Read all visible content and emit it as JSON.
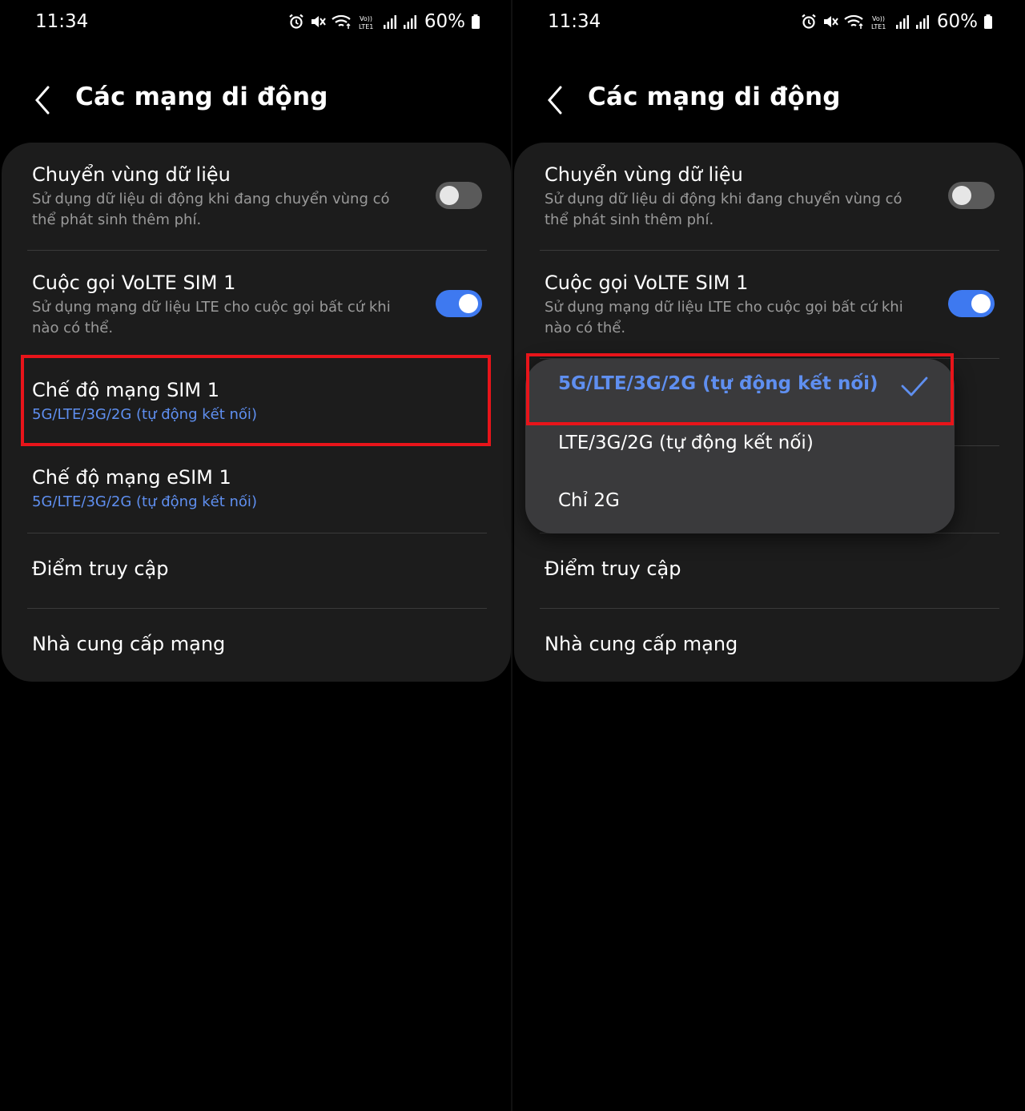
{
  "left": {
    "status": {
      "time": "11:34",
      "battery": "60%"
    },
    "header": {
      "title": "Các mạng di động"
    },
    "items": [
      {
        "title": "Chuyển vùng dữ liệu",
        "subtitle": "Sử dụng dữ liệu di động khi đang chuyển vùng có thể phát sinh thêm phí.",
        "toggle": "off"
      },
      {
        "title": "Cuộc gọi VoLTE SIM 1",
        "subtitle": "Sử dụng mạng dữ liệu LTE cho cuộc gọi bất cứ khi nào có thể.",
        "toggle": "on"
      },
      {
        "title": "Chế độ mạng SIM 1",
        "value": "5G/LTE/3G/2G (tự động kết nối)"
      },
      {
        "title": "Chế độ mạng eSIM 1",
        "value": "5G/LTE/3G/2G (tự động kết nối)"
      },
      {
        "title": "Điểm truy cập"
      },
      {
        "title": "Nhà cung cấp mạng"
      }
    ]
  },
  "right": {
    "status": {
      "time": "11:34",
      "battery": "60%"
    },
    "header": {
      "title": "Các mạng di động"
    },
    "items": [
      {
        "title": "Chuyển vùng dữ liệu",
        "subtitle": "Sử dụng dữ liệu di động khi đang chuyển vùng có thể phát sinh thêm phí.",
        "toggle": "off"
      },
      {
        "title": "Cuộc gọi VoLTE SIM 1",
        "subtitle": "Sử dụng mạng dữ liệu LTE cho cuộc gọi bất cứ khi nào có thể.",
        "toggle": "on"
      },
      {
        "title": "Điểm truy cập"
      },
      {
        "title": "Nhà cung cấp mạng"
      }
    ],
    "network_mode_menu": {
      "options": [
        {
          "label": "5G/LTE/3G/2G (tự động kết nối)",
          "selected": true
        },
        {
          "label": "LTE/3G/2G (tự động kết nối)",
          "selected": false
        },
        {
          "label": "Chỉ 2G",
          "selected": false
        }
      ]
    }
  },
  "colors": {
    "accent": "#5f8ff0",
    "toggle_on": "#3e79f0",
    "highlight": "#e8141a",
    "card": "#1c1c1c"
  }
}
